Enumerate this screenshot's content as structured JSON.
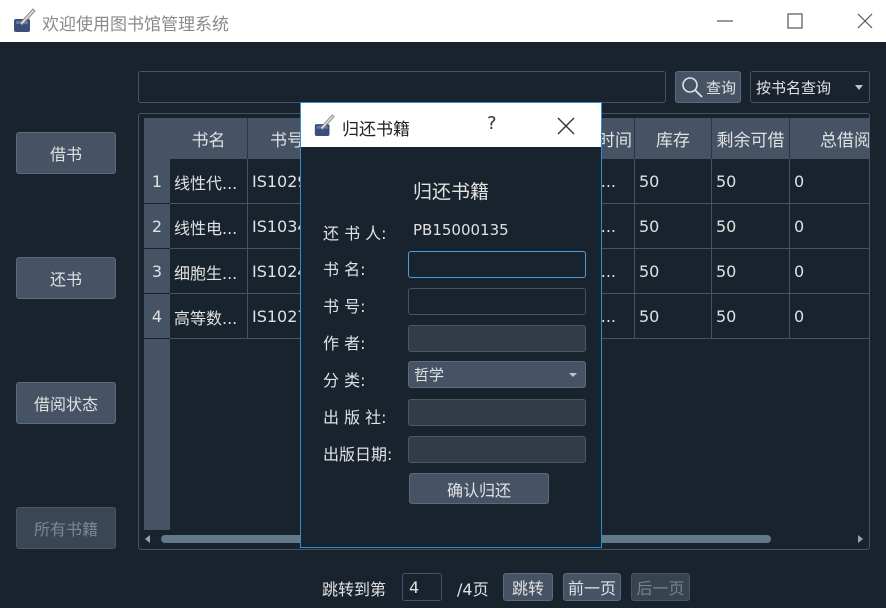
{
  "window": {
    "title": "欢迎使用图书馆管理系统",
    "icon": "quill-ink-icon"
  },
  "sidebar": {
    "borrow_label": "借书",
    "return_label": "还书",
    "status_label": "借阅状态",
    "all_books_label": "所有书籍"
  },
  "search": {
    "value": "",
    "button_label": "查询",
    "mode": "按书名查询"
  },
  "table": {
    "columns": [
      "书名",
      "书号",
      "时间",
      "库存",
      "剩余可借",
      "总借阅"
    ],
    "rows": [
      {
        "num": "1",
        "name": "线性代...",
        "isbn": "IS1029",
        "time": "...",
        "stock": "50",
        "remaining": "50",
        "total": "0"
      },
      {
        "num": "2",
        "name": "线性电...",
        "isbn": "IS1034",
        "time": "...",
        "stock": "50",
        "remaining": "50",
        "total": "0"
      },
      {
        "num": "3",
        "name": "细胞生...",
        "isbn": "IS1024",
        "time": "...",
        "stock": "50",
        "remaining": "50",
        "total": "0"
      },
      {
        "num": "4",
        "name": "高等数...",
        "isbn": "IS1027",
        "time": "...",
        "stock": "50",
        "remaining": "50",
        "total": "0"
      }
    ]
  },
  "pager": {
    "jump_label": "跳转到第",
    "page_value": "4",
    "total_label": "/4页",
    "jump_button": "跳转",
    "prev_button": "前一页",
    "next_button": "后一页"
  },
  "dialog": {
    "title": "归还书籍",
    "help": "?",
    "heading": "归还书籍",
    "returner_label": "还 书 人:",
    "returner_value": "PB15000135",
    "book_name_label": "书    名:",
    "book_number_label": "书    号:",
    "author_label": "作    者:",
    "category_label": "分    类:",
    "category_value": "哲学",
    "publisher_label": "出 版 社:",
    "publish_date_label": "出版日期:",
    "confirm_button": "确认归还",
    "book_name_value": "",
    "book_number_value": "",
    "author_value": "",
    "publisher_value": "",
    "publish_date_value": ""
  },
  "colors": {
    "background": "#19232d",
    "button": "#455364",
    "focus_border": "#4a9ee0",
    "dialog_border": "#2a8fd6"
  }
}
